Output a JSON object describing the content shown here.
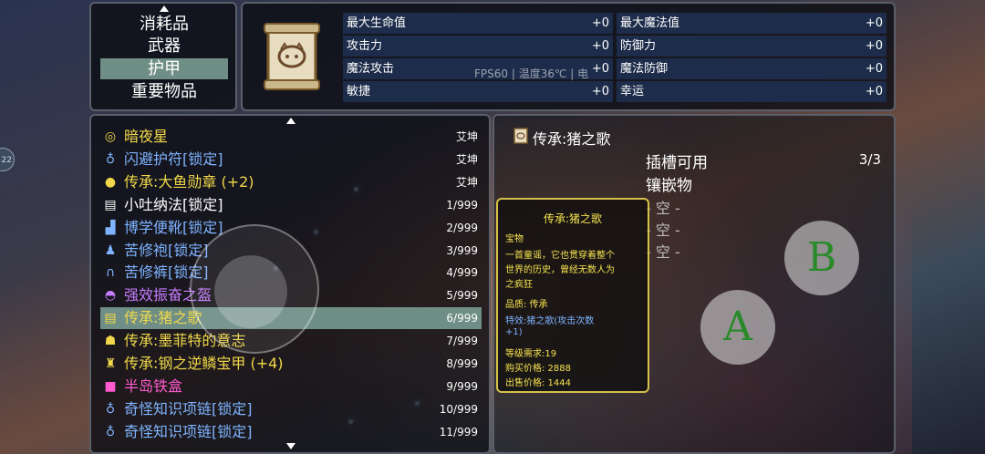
{
  "menu": {
    "items": [
      {
        "label": "消耗品",
        "selected": false
      },
      {
        "label": "武器",
        "selected": false
      },
      {
        "label": "护甲",
        "selected": true
      },
      {
        "label": "重要物品",
        "selected": false
      }
    ]
  },
  "stats": {
    "left": [
      {
        "name": "最大生命值",
        "value": "+0"
      },
      {
        "name": "攻击力",
        "value": "+0"
      },
      {
        "name": "魔法攻击",
        "value": "+0"
      },
      {
        "name": "敏捷",
        "value": "+0"
      }
    ],
    "right": [
      {
        "name": "最大魔法值",
        "value": "+0"
      },
      {
        "name": "防御力",
        "value": "+0"
      },
      {
        "name": "魔法防御",
        "value": "+0"
      },
      {
        "name": "幸运",
        "value": "+0"
      }
    ],
    "overlay": "FPS60 | 温度36℃ | 电"
  },
  "items": [
    {
      "icon": "ring-icon",
      "glyph": "◎",
      "name": "暗夜星",
      "count": "艾坤",
      "color": "#f0d84a"
    },
    {
      "icon": "amulet-icon",
      "glyph": "♁",
      "name": "闪避护符[锁定]",
      "count": "艾坤",
      "color": "#7fb3ff"
    },
    {
      "icon": "medal-icon",
      "glyph": "●",
      "name": "传承:大鱼勋章 (+2)",
      "count": "艾坤",
      "color": "#f0d84a"
    },
    {
      "icon": "scroll-icon",
      "glyph": "▤",
      "name": "小吐纳法[锁定]",
      "count": "1/999",
      "color": "#ffffff"
    },
    {
      "icon": "boots-icon",
      "glyph": "▟",
      "name": "博学便靴[锁定]",
      "count": "2/999",
      "color": "#7fb3ff"
    },
    {
      "icon": "robe-icon",
      "glyph": "♟",
      "name": "苦修袍[锁定]",
      "count": "3/999",
      "color": "#7fb3ff"
    },
    {
      "icon": "pants-icon",
      "glyph": "∩",
      "name": "苦修裤[锁定]",
      "count": "4/999",
      "color": "#7fb3ff"
    },
    {
      "icon": "helmet-icon",
      "glyph": "◓",
      "name": "强效振奋之盔",
      "count": "5/999",
      "color": "#c77bff"
    },
    {
      "icon": "scroll-icon",
      "glyph": "▤",
      "name": "传承:猪之歌",
      "count": "6/999",
      "color": "#f0d84a",
      "selected": true
    },
    {
      "icon": "mask-icon",
      "glyph": "☗",
      "name": "传承:墨菲特的意志",
      "count": "7/999",
      "color": "#f0d84a"
    },
    {
      "icon": "armor-icon",
      "glyph": "♜",
      "name": "传承:钢之逆鳞宝甲 (+4)",
      "count": "8/999",
      "color": "#f0d84a"
    },
    {
      "icon": "box-icon",
      "glyph": "■",
      "name": "半岛铁盒",
      "count": "9/999",
      "color": "#ff5ad0"
    },
    {
      "icon": "necklace-icon",
      "glyph": "♁",
      "name": "奇怪知识项链[锁定]",
      "count": "10/999",
      "color": "#7fb3ff"
    },
    {
      "icon": "necklace-icon",
      "glyph": "♁",
      "name": "奇怪知识项链[锁定]",
      "count": "11/999",
      "color": "#7fb3ff"
    }
  ],
  "detail": {
    "title": "传承:猪之歌",
    "slot_label": "插槽可用",
    "slot_count": "3/3",
    "inlay_label": "镶嵌物",
    "slots": [
      "- 空 -",
      "- 空 -",
      "- 空 -"
    ],
    "tooltip": {
      "title": "传承:猪之歌",
      "type": "宝物",
      "desc1": "一首童谣，它也贯穿着整个",
      "desc2": "世界的历史，曾经无数人为",
      "desc3": "之疯狂",
      "quality": "品质: 传承",
      "effect1": "特效:猪之歌(攻击次数",
      "effect2": "+1)",
      "level": "等级需求:19",
      "buy": "购买价格: 2888",
      "sell": "出售价格: 1444"
    }
  },
  "controls": {
    "a_label": "A",
    "b_label": "B",
    "edge_label": "22"
  }
}
